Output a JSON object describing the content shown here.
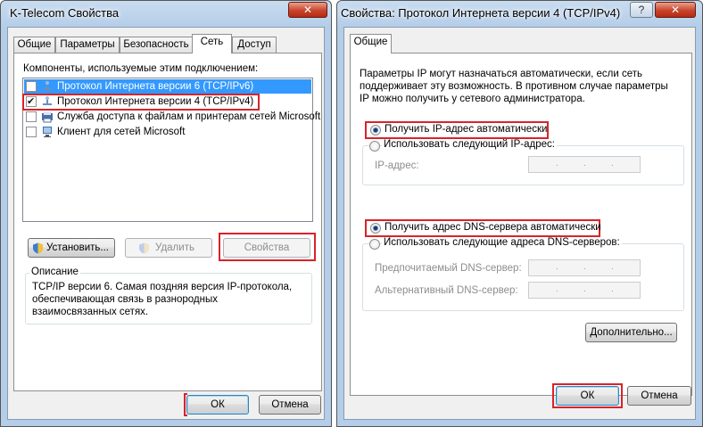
{
  "left_window": {
    "title": "K-Telecom Свойства",
    "controls": {
      "close": "✕"
    },
    "tabs": [
      "Общие",
      "Параметры",
      "Безопасность",
      "Сеть",
      "Доступ"
    ],
    "active_tab": "Сеть",
    "components_label": "Компоненты, используемые этим подключением:",
    "components": [
      {
        "label": "Протокол Интернета версии 6 (TCP/IPv6)",
        "checked": false,
        "selected": true,
        "icon": "network-protocol-icon"
      },
      {
        "label": "Протокол Интернета версии 4 (TCP/IPv4)",
        "checked": true,
        "selected": false,
        "icon": "network-protocol-icon"
      },
      {
        "label": "Служба доступа к файлам и принтерам сетей Microsoft",
        "checked": false,
        "selected": false,
        "icon": "file-printer-sharing-icon"
      },
      {
        "label": "Клиент для сетей Microsoft",
        "checked": false,
        "selected": false,
        "icon": "network-client-icon"
      }
    ],
    "buttons": {
      "install": "Установить...",
      "remove": "Удалить",
      "properties": "Свойства"
    },
    "description": {
      "label": "Описание",
      "text_lines": [
        "TCP/IP версии 6. Самая поздняя версия IP-протокола,",
        "обеспечивающая связь в разнородных",
        "взаимосвязанных сетях."
      ]
    },
    "footer": {
      "ok": "ОК",
      "cancel": "Отмена"
    }
  },
  "right_window": {
    "title": "Свойства: Протокол Интернета версии 4 (TCP/IPv4)",
    "controls": {
      "help": "?",
      "close": "✕"
    },
    "tabs": [
      "Общие"
    ],
    "intro_lines": [
      "Параметры IP могут назначаться автоматически, если сеть",
      "поддерживает эту возможность. В противном случае параметры",
      "IP можно получить у сетевого администратора."
    ],
    "ip_auto": "Получить IP-адрес автоматически",
    "ip_manual": "Использовать следующий IP-адрес:",
    "ip_address_label": "IP-адрес:",
    "dns_auto": "Получить адрес DNS-сервера автоматически",
    "dns_manual": "Использовать следующие адреса DNS-серверов:",
    "preferred_dns_label": "Предпочитаемый DNS-сервер:",
    "alternate_dns_label": "Альтернативный DNS-сервер:",
    "ip_dot": ".",
    "advanced": "Дополнительно...",
    "footer": {
      "ok": "ОК",
      "cancel": "Отмена"
    }
  }
}
